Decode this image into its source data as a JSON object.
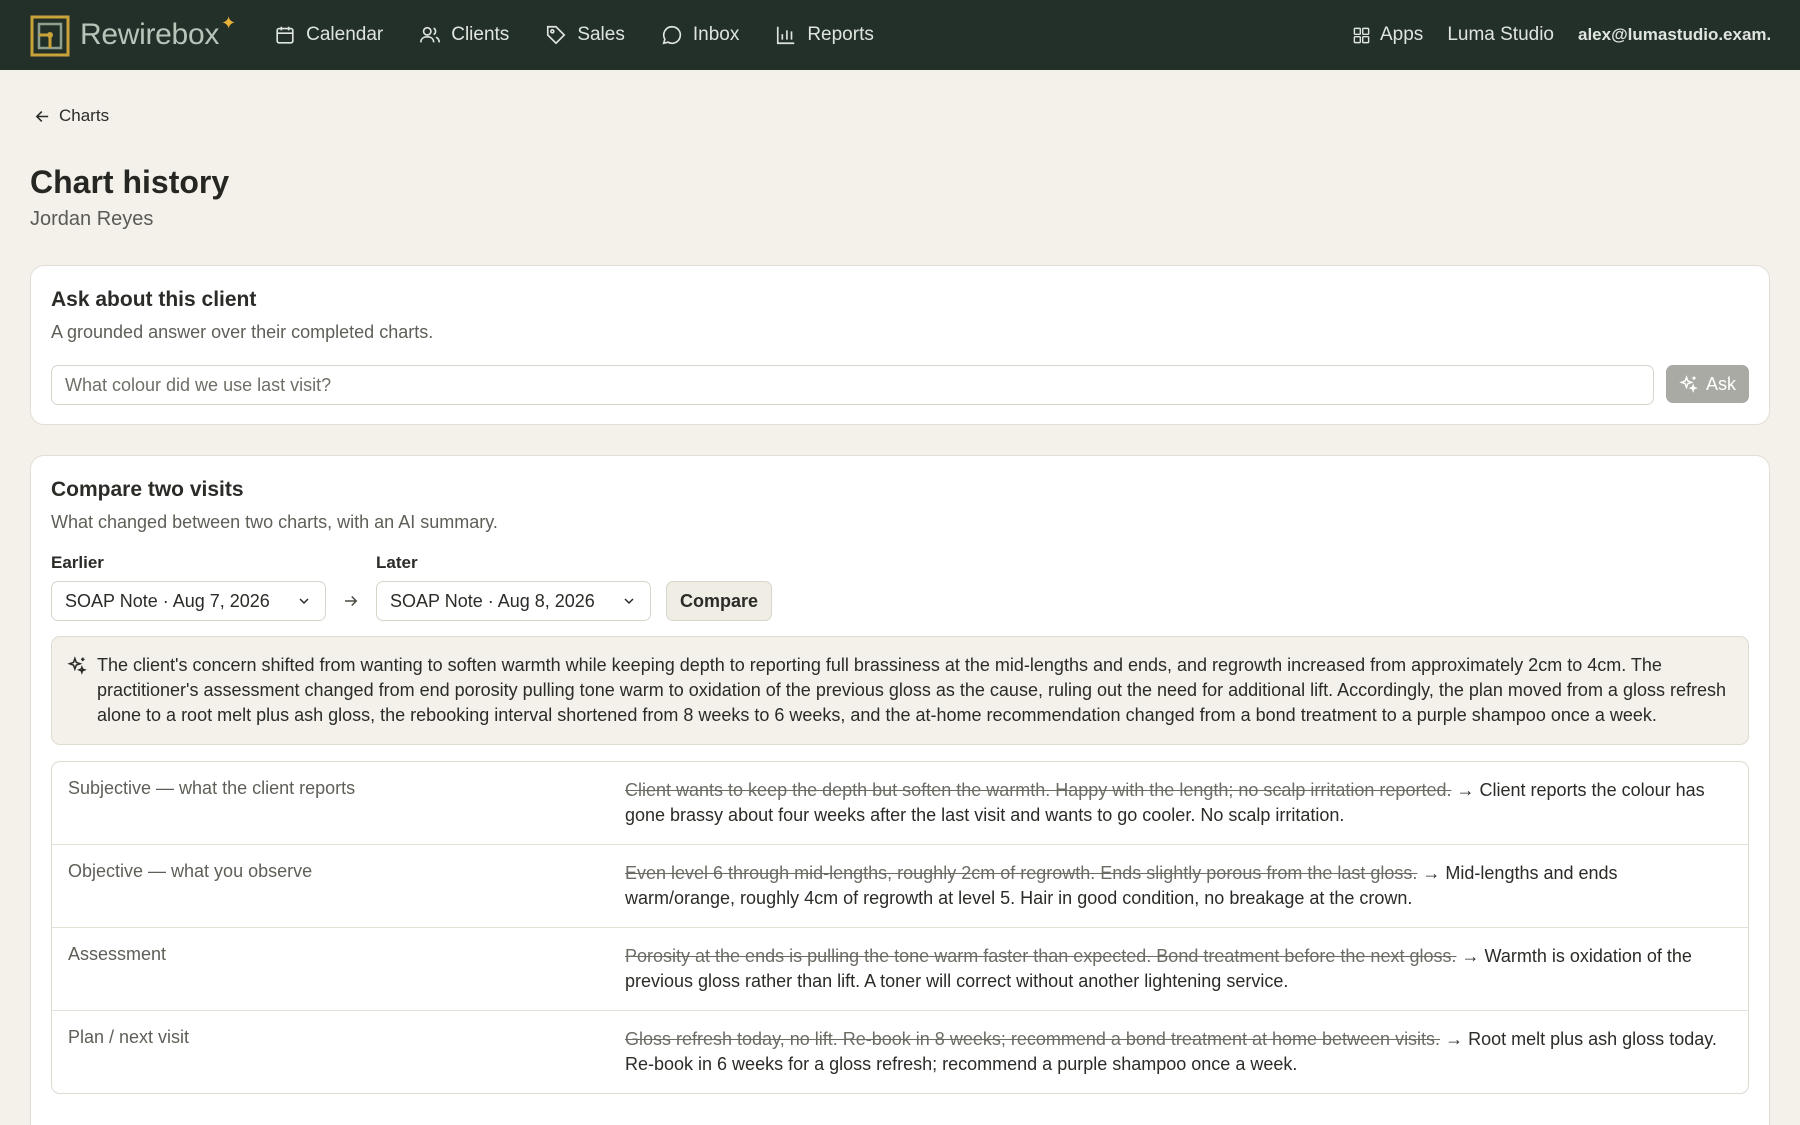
{
  "brand": {
    "name": "Rewirebox",
    "accent": "#e8b23a"
  },
  "nav": {
    "items": [
      {
        "label": "Calendar",
        "icon": "calendar-icon"
      },
      {
        "label": "Clients",
        "icon": "users-icon"
      },
      {
        "label": "Sales",
        "icon": "tag-icon"
      },
      {
        "label": "Inbox",
        "icon": "chat-bubble-icon"
      },
      {
        "label": "Reports",
        "icon": "bar-chart-icon"
      }
    ],
    "apps_label": "Apps",
    "workspace": "Luma Studio",
    "user_email": "alex@lumastudio.exam..."
  },
  "back_label": "Charts",
  "page": {
    "title": "Chart history",
    "client_name": "Jordan Reyes"
  },
  "ask": {
    "title": "Ask about this client",
    "description": "A grounded answer over their completed charts.",
    "placeholder": "What colour did we use last visit?",
    "button_label": "Ask"
  },
  "compare": {
    "title": "Compare two visits",
    "description": "What changed between two charts, with an AI summary.",
    "earlier_label": "Earlier",
    "earlier_value": "SOAP Note · Aug 7, 2026",
    "later_label": "Later",
    "later_value": "SOAP Note · Aug 8, 2026",
    "button_label": "Compare",
    "summary": "The client's concern shifted from wanting to soften warmth while keeping depth to reporting full brassiness at the mid-lengths and ends, and regrowth increased from approximately 2cm to 4cm. The practitioner's assessment changed from end porosity pulling tone warm to oxidation of the previous gloss as the cause, ruling out the need for additional lift. Accordingly, the plan moved from a gloss refresh alone to a root melt plus ash gloss, the rebooking interval shortened from 8 weeks to 6 weeks, and the at-home recommendation changed from a bond treatment to a purple shampoo once a week.",
    "rows": [
      {
        "label": "Subjective — what the client reports",
        "old": "Client wants to keep the depth but soften the warmth. Happy with the length; no scalp irritation reported.",
        "new": "Client reports the colour has gone brassy about four weeks after the last visit and wants to go cooler. No scalp irritation."
      },
      {
        "label": "Objective — what you observe",
        "old": "Even level 6 through mid-lengths, roughly 2cm of regrowth. Ends slightly porous from the last gloss.",
        "new": "Mid-lengths and ends warm/orange, roughly 4cm of regrowth at level 5. Hair in good condition, no breakage at the crown."
      },
      {
        "label": "Assessment",
        "old": "Porosity at the ends is pulling the tone warm faster than expected. Bond treatment before the next gloss.",
        "new": "Warmth is oxidation of the previous gloss rather than lift. A toner will correct without another lightening service."
      },
      {
        "label": "Plan / next visit",
        "old": "Gloss refresh today, no lift. Re-book in 8 weeks; recommend a bond treatment at home between visits.",
        "new": "Root melt plus ash gloss today. Re-book in 6 weeks for a gloss refresh; recommend a purple shampoo once a week."
      }
    ],
    "arrow": "→"
  }
}
